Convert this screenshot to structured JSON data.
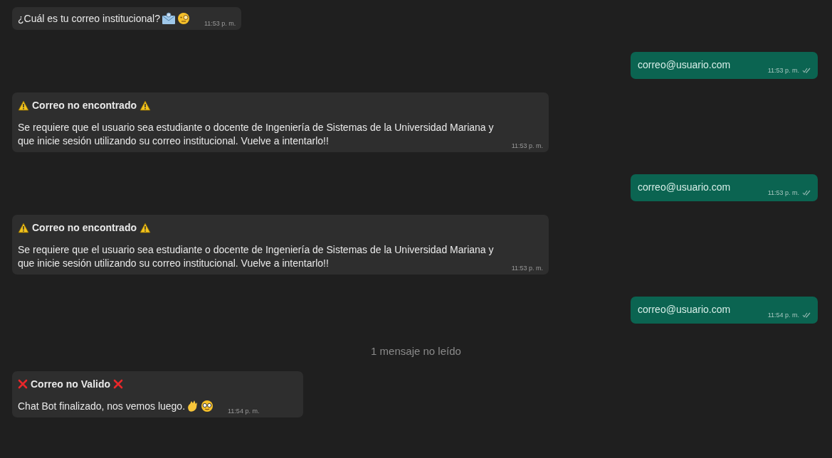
{
  "messages": [
    {
      "kind": "question",
      "text": "¿Cuál es tu correo institucional?",
      "time": "11:53 p. m."
    },
    {
      "kind": "sent",
      "text": "correo@usuario.com",
      "time": "11:53 p. m."
    },
    {
      "kind": "alert",
      "title": "Correo no encontrado",
      "text": "Se requiere que el usuario sea estudiante o docente de Ingeniería de Sistemas de la Universidad Mariana y que inicie sesión utilizando su correo institucional. Vuelve a intentarlo!!",
      "time": "11:53 p. m."
    },
    {
      "kind": "sent",
      "text": "correo@usuario.com",
      "time": "11:53 p. m."
    },
    {
      "kind": "alert",
      "title": "Correo no encontrado",
      "text": "Se requiere que el usuario sea estudiante o docente de Ingeniería de Sistemas de la Universidad Mariana y que inicie sesión utilizando su correo institucional. Vuelve a intentarlo!!",
      "time": "11:53 p. m."
    },
    {
      "kind": "sent",
      "text": "correo@usuario.com",
      "time": "11:54 p. m."
    },
    {
      "kind": "divider",
      "text": "1 mensaje no leído"
    },
    {
      "kind": "farewell",
      "title": "Correo no Valido",
      "text": "Chat Bot finalizado, nos vemos luego.",
      "time": "11:54 p. m."
    }
  ]
}
